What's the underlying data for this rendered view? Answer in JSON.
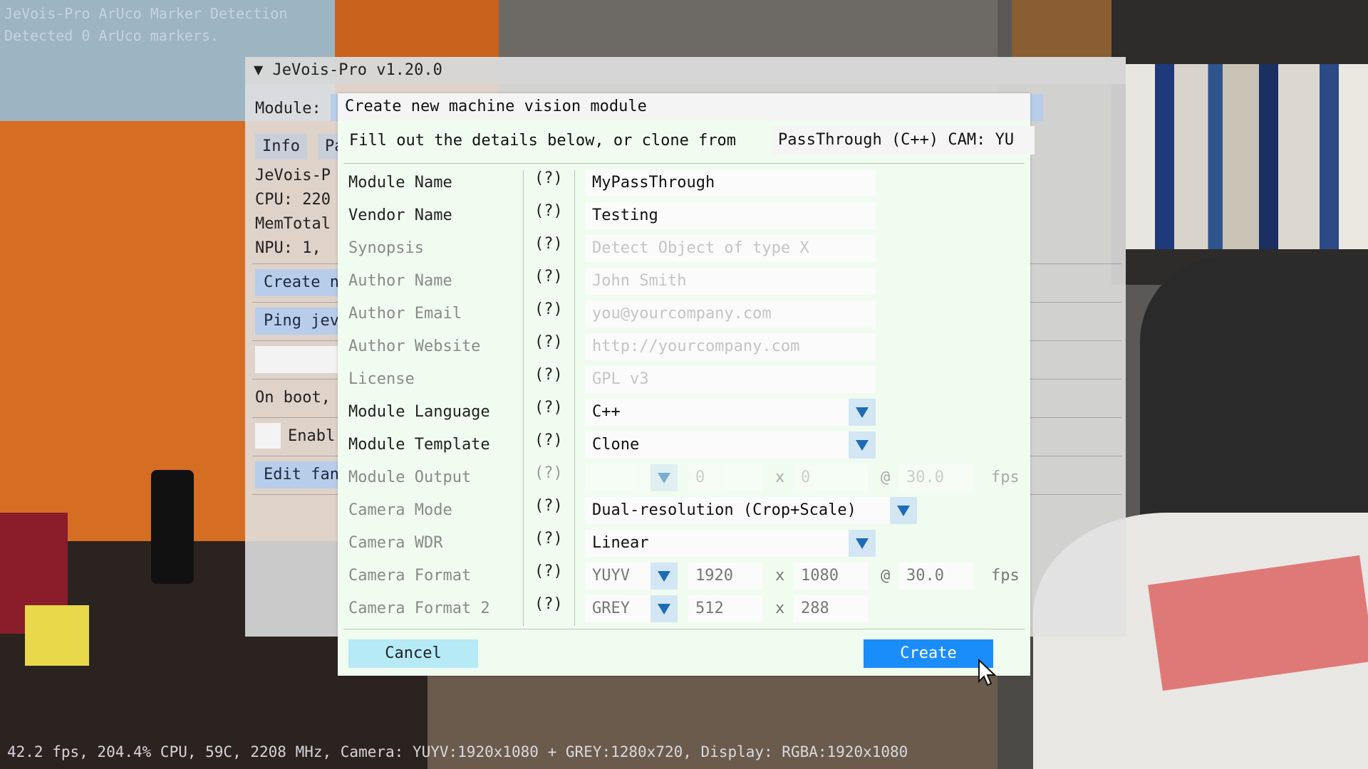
{
  "overlay": {
    "line1": "JeVois-Pro ArUco Marker Detection",
    "line2": "Detected 0 ArUco markers."
  },
  "main_window": {
    "title": "JeVois-Pro v1.20.0",
    "module_label": "Module:",
    "tabs": [
      "Info",
      "Pa"
    ],
    "info_lines": [
      "JeVois-P",
      "CPU: 220",
      "MemTotal",
      "NPU: 1, "
    ],
    "buttons": {
      "create": "Create n",
      "ping": "Ping jev",
      "edit": "Edit fan"
    },
    "on_boot": "On boot,",
    "enable": "Enabl"
  },
  "dialog": {
    "title": "Create new machine vision module",
    "intro": "Fill out the details below, or clone from",
    "clone_source": "PassThrough (C++) CAM: YU",
    "help_marker": "(?)",
    "fields": [
      {
        "label": "Module Name",
        "value": "MyPassThrough",
        "placeholder": ""
      },
      {
        "label": "Vendor Name",
        "value": "Testing",
        "placeholder": ""
      },
      {
        "label": "Synopsis",
        "value": "",
        "placeholder": "Detect Object of type X"
      },
      {
        "label": "Author Name",
        "value": "",
        "placeholder": "John Smith"
      },
      {
        "label": "Author Email",
        "value": "",
        "placeholder": "you@yourcompany.com"
      },
      {
        "label": "Author Website",
        "value": "",
        "placeholder": "http://yourcompany.com"
      },
      {
        "label": "License",
        "value": "",
        "placeholder": "GPL v3"
      }
    ],
    "module_language": {
      "label": "Module Language",
      "value": "C++"
    },
    "module_template": {
      "label": "Module Template",
      "value": "Clone"
    },
    "module_output": {
      "label": "Module Output",
      "format": "",
      "width": "0",
      "height": "0",
      "fps": "30.0"
    },
    "camera_mode": {
      "label": "Camera Mode",
      "value": "Dual-resolution (Crop+Scale)"
    },
    "camera_wdr": {
      "label": "Camera WDR",
      "value": "Linear"
    },
    "camera_format": {
      "label": "Camera Format",
      "format": "YUYV",
      "width": "1920",
      "height": "1080",
      "fps": "30.0"
    },
    "camera_format2": {
      "label": "Camera Format 2",
      "format": "GREY",
      "width": "512",
      "height": "288"
    },
    "x_sep": "x",
    "at_sep": "@",
    "fps_unit": "fps",
    "cancel_label": "Cancel",
    "create_label": "Create"
  },
  "status_bar": "42.2 fps, 204.4% CPU, 59C, 2208 MHz, Camera: YUYV:1920x1080 + GREY:1280x720, Display: RGBA:1920x1080"
}
